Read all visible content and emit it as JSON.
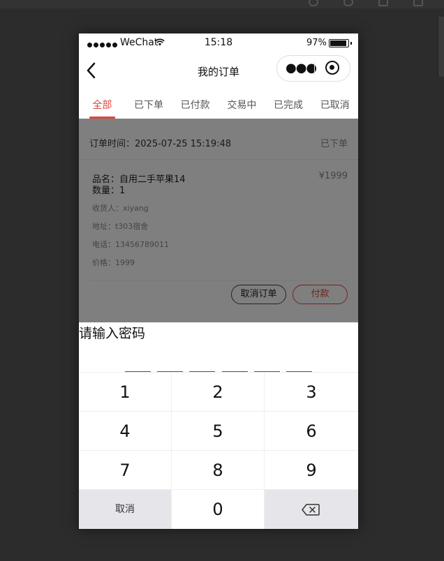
{
  "status_bar": {
    "carrier": "WeChat",
    "time": "15:18",
    "battery": "97%"
  },
  "nav": {
    "title": "我的订单",
    "more_icon": "more-dots-icon",
    "close_icon": "close-miniprogram-icon",
    "back_icon": "chevron-left-icon"
  },
  "tabs": [
    "全部",
    "已下单",
    "已付款",
    "交易中",
    "已完成",
    "已取消"
  ],
  "active_tab": "全部",
  "order": {
    "time_label": "订单时间：",
    "time": "2025-07-25 15:19:48",
    "status": "已下单",
    "name_label": "品名：",
    "name": "自用二手苹果14",
    "qty_label": "数量：",
    "qty": "1",
    "price": "¥1999",
    "receiver_label": "收货人：",
    "receiver": "xiyang",
    "address_label": "地址：",
    "address": "t303宿舍",
    "phone_label": "电话：",
    "phone": "13456789011",
    "amount_label": "价格：",
    "amount": "1999",
    "cancel_button": "取消订单",
    "pay_button": "付款"
  },
  "password_dialog": {
    "title": "请输入密码",
    "digits_entered": 0,
    "digits_total": 6
  },
  "keypad": {
    "keys": [
      "1",
      "2",
      "3",
      "4",
      "5",
      "6",
      "7",
      "8",
      "9"
    ],
    "cancel": "取消",
    "zero": "0",
    "backspace_icon": "backspace-icon"
  },
  "colors": {
    "accent": "#e0463d",
    "window_bg": "#2c2c2c",
    "keypad_gray": "#e6e6ea"
  }
}
